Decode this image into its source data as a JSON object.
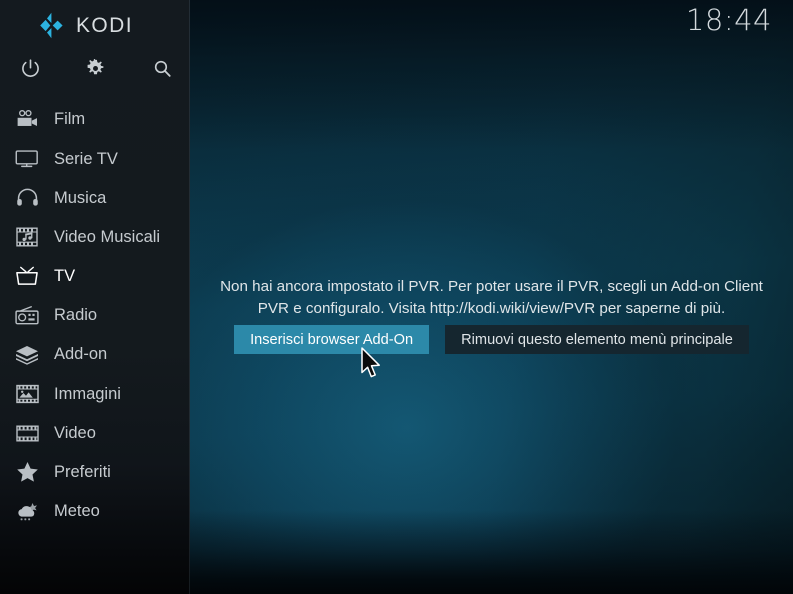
{
  "app": {
    "name": "KODI",
    "logo_color": "#2cb3e0",
    "clock": "18:44"
  },
  "sidebar": {
    "quick_icons": [
      {
        "name": "power-icon",
        "label": "Power"
      },
      {
        "name": "gear-icon",
        "label": "Impostazioni"
      },
      {
        "name": "search-icon",
        "label": "Cerca"
      }
    ],
    "items": [
      {
        "label": "Film",
        "icon": "movie-camera-icon",
        "selected": false
      },
      {
        "label": "Serie TV",
        "icon": "monitor-icon",
        "selected": false
      },
      {
        "label": "Musica",
        "icon": "headphones-icon",
        "selected": false
      },
      {
        "label": "Video Musicali",
        "icon": "music-video-icon",
        "selected": false
      },
      {
        "label": "TV",
        "icon": "television-icon",
        "selected": true
      },
      {
        "label": "Radio",
        "icon": "radio-icon",
        "selected": false
      },
      {
        "label": "Add-on",
        "icon": "box-icon",
        "selected": false
      },
      {
        "label": "Immagini",
        "icon": "picture-icon",
        "selected": false
      },
      {
        "label": "Video",
        "icon": "film-strip-icon",
        "selected": false
      },
      {
        "label": "Preferiti",
        "icon": "star-icon",
        "selected": false
      },
      {
        "label": "Meteo",
        "icon": "weather-cloud-icon",
        "selected": false
      }
    ]
  },
  "main": {
    "message": "Non hai ancora impostato il PVR. Per poter usare il PVR, scegli un Add-on Client PVR e configuralo. Visita http://kodi.wiki/view/PVR per saperne di più.",
    "buttons": [
      {
        "label": "Inserisci browser Add-On",
        "focused": true,
        "color": "#2c89a9"
      },
      {
        "label": "Rimuovi questo elemento menù principale",
        "focused": false,
        "color": "#15262f"
      }
    ]
  }
}
